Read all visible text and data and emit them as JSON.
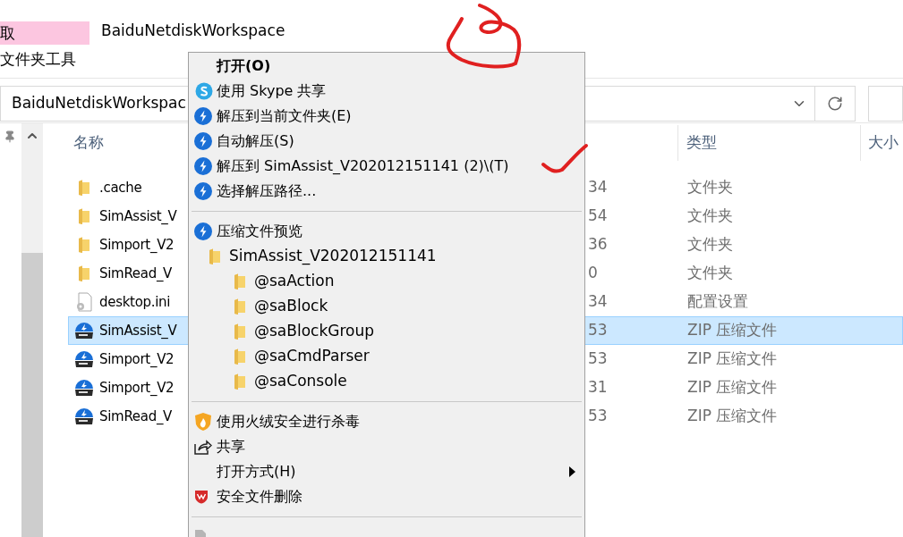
{
  "ribbon": {
    "active_tab": {
      "label": "取"
    },
    "context_tab": {
      "label": "文件夹工具"
    },
    "window_title": "BaiduNetdiskWorkspace"
  },
  "address_bar": {
    "path": "BaiduNetdiskWorkspac"
  },
  "file_list": {
    "columns": [
      "名称",
      "类型",
      "大小"
    ],
    "rows": [
      {
        "kind": "folder",
        "name": ".cache",
        "column_2": "34",
        "type": "文件夹",
        "selected": false
      },
      {
        "kind": "folder",
        "name": "SimAssist_V",
        "column_2": "54",
        "type": "文件夹",
        "selected": false
      },
      {
        "kind": "folder",
        "name": "Simport_V2",
        "column_2": "36",
        "type": "文件夹",
        "selected": false
      },
      {
        "kind": "folder",
        "name": "SimRead_V",
        "column_2": "0",
        "type": "文件夹",
        "selected": false
      },
      {
        "kind": "ini",
        "name": "desktop.ini",
        "column_2": "34",
        "type": "配置设置",
        "selected": false
      },
      {
        "kind": "zip",
        "name": "SimAssist_V",
        "column_2": "53",
        "type": "ZIP 压缩文件",
        "selected": true
      },
      {
        "kind": "zip",
        "name": "Simport_V2",
        "column_2": "53",
        "type": "ZIP 压缩文件",
        "selected": false
      },
      {
        "kind": "zip",
        "name": "Simport_V2",
        "column_2": "31",
        "type": "ZIP 压缩文件",
        "selected": false
      },
      {
        "kind": "zip",
        "name": "SimRead_V",
        "column_2": "53",
        "type": "ZIP 压缩文件",
        "selected": false
      }
    ]
  },
  "context_menu": {
    "items": [
      {
        "kind": "plain",
        "label": "打开(O)",
        "default": true,
        "submenu": false,
        "disabled": false
      },
      {
        "kind": "skype",
        "label": "使用 Skype 共享",
        "default": false,
        "submenu": false,
        "disabled": false
      },
      {
        "kind": "bandizip",
        "label": "解压到当前文件夹(E)",
        "default": false,
        "submenu": false,
        "disabled": false
      },
      {
        "kind": "bandizip",
        "label": "自动解压(S)",
        "default": false,
        "submenu": false,
        "disabled": false
      },
      {
        "kind": "bandizip",
        "label": "解压到 SimAssist_V202012151141 (2)\\(T)",
        "default": false,
        "submenu": false,
        "disabled": false
      },
      {
        "kind": "bandizip",
        "label": "选择解压路径...",
        "default": false,
        "submenu": false,
        "disabled": false
      },
      {
        "kind": "separator"
      },
      {
        "kind": "bandizip",
        "label": "压缩文件预览",
        "default": false,
        "submenu": false,
        "disabled": false
      },
      {
        "kind": "tree",
        "folders": [
          {
            "label": "SimAssist_V202012151141",
            "children": [
              {
                "label": "@saAction"
              },
              {
                "label": "@saBlock"
              },
              {
                "label": "@saBlockGroup"
              },
              {
                "label": "@saCmdParser"
              },
              {
                "label": "@saConsole"
              }
            ]
          }
        ]
      },
      {
        "kind": "separator"
      },
      {
        "kind": "huorong",
        "label": "使用火绒安全进行杀毒",
        "default": false,
        "submenu": false,
        "disabled": false
      },
      {
        "kind": "share",
        "label": "共享",
        "default": false,
        "submenu": false,
        "disabled": false
      },
      {
        "kind": "plain",
        "label": "打开方式(H)",
        "default": false,
        "submenu": true,
        "disabled": false
      },
      {
        "kind": "shield",
        "label": "安全文件删除",
        "default": false,
        "submenu": false,
        "disabled": false
      },
      {
        "kind": "separator"
      },
      {
        "kind": "file",
        "disabled": true
      }
    ]
  }
}
